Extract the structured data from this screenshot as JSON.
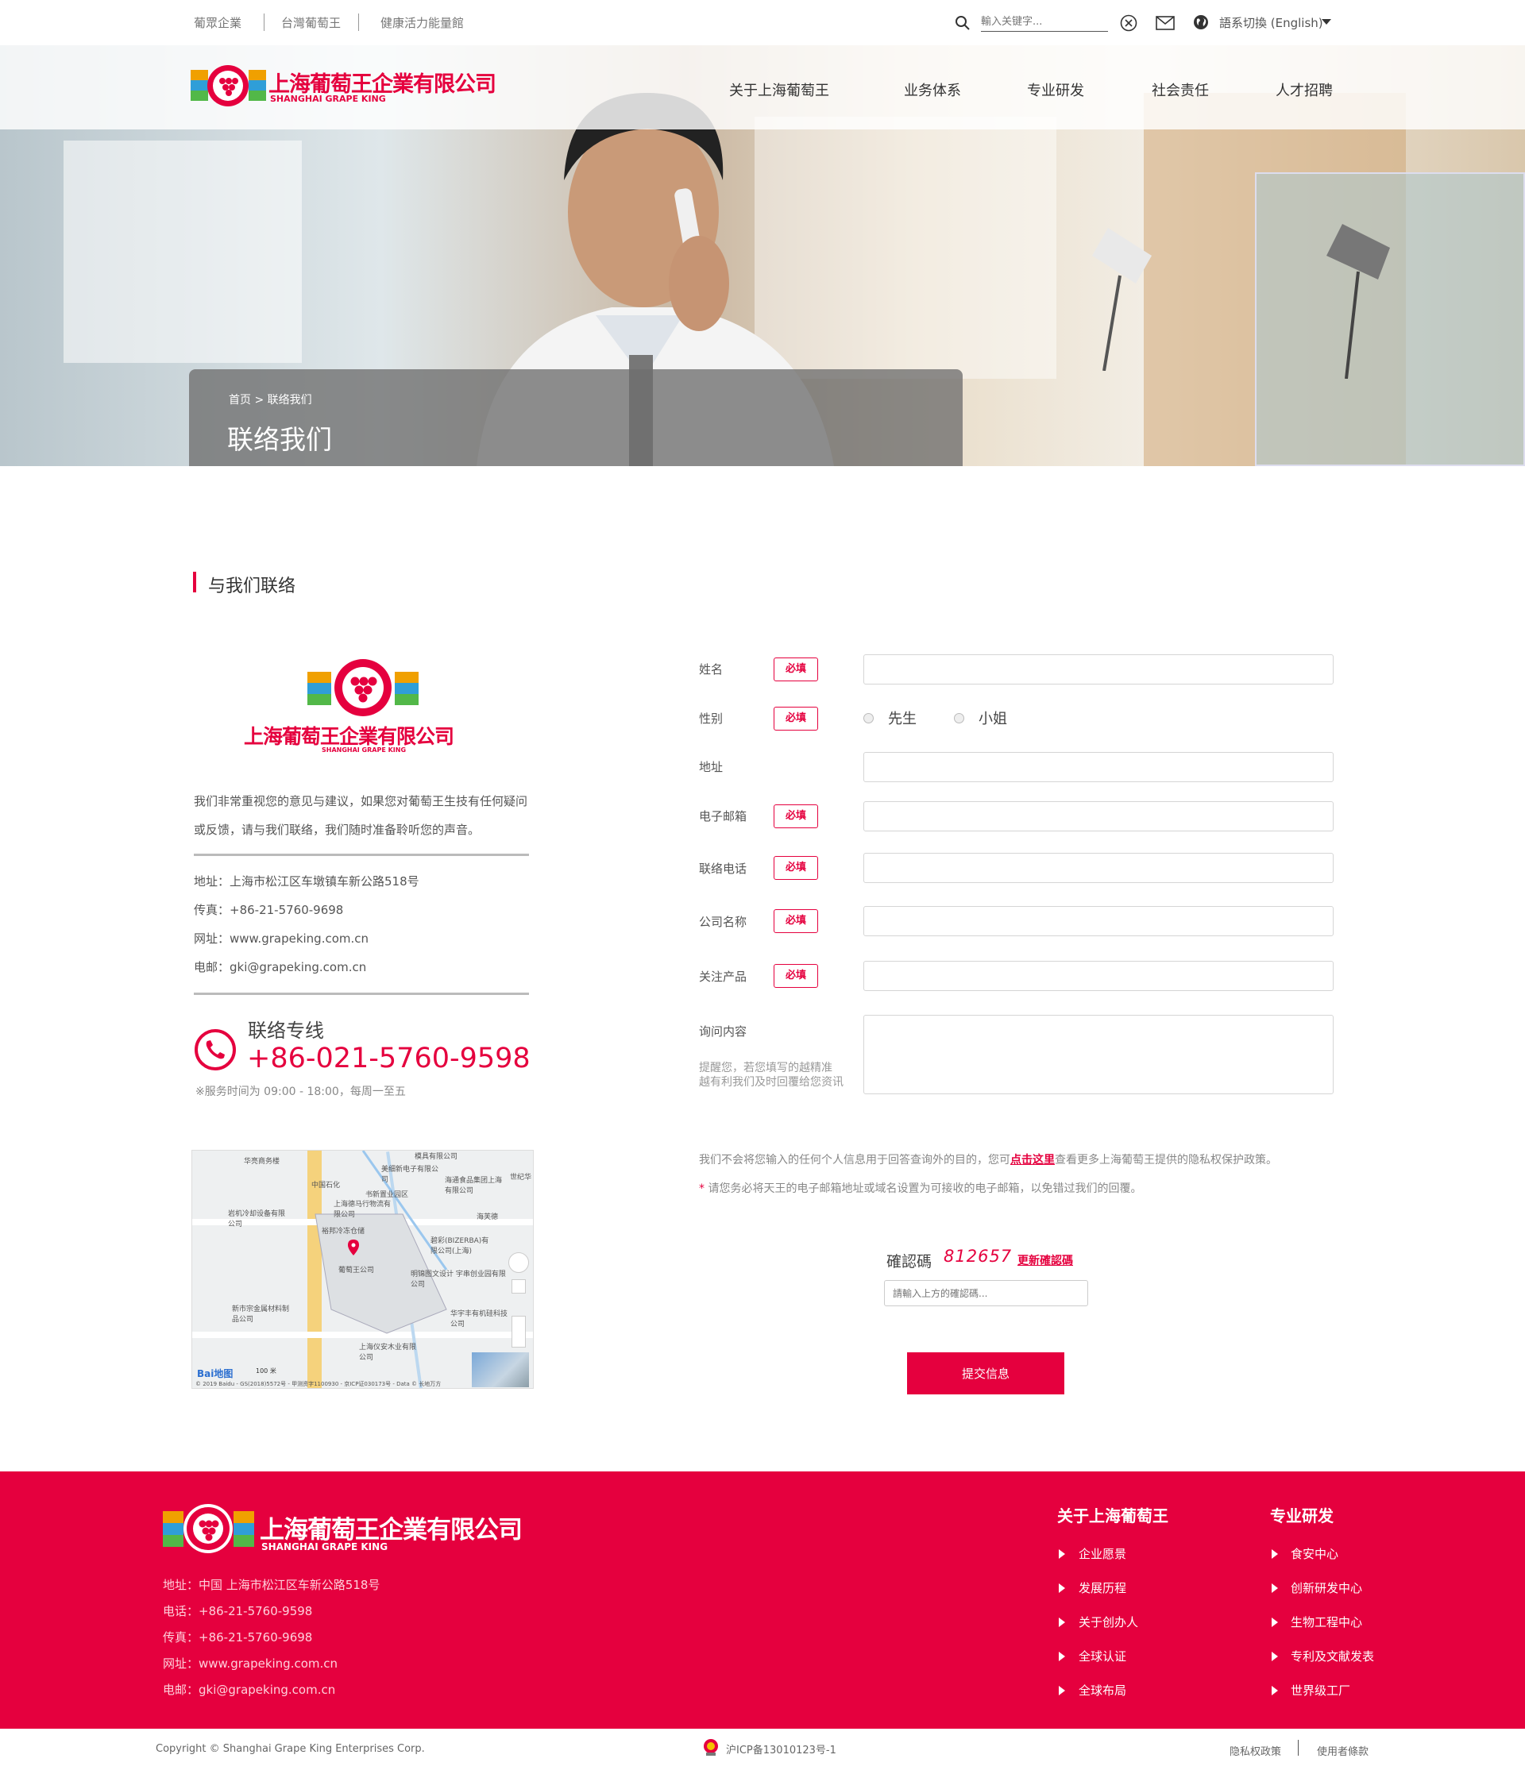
{
  "topbar": {
    "links": [
      "葡眾企業",
      "台灣葡萄王",
      "健康活力能量館"
    ],
    "search_placeholder": "輸入关键字...",
    "language": "語系切換 (English)"
  },
  "logo": {
    "cn": "上海葡萄王企業有限公司",
    "en": "SHANGHAI GRAPE KING"
  },
  "nav": [
    "关于上海葡萄王",
    "业务体系",
    "专业研发",
    "社会责任",
    "人才招聘"
  ],
  "breadcrumb": {
    "home": "首页",
    "sep": ">",
    "current": "联络我们"
  },
  "hero_title": "联络我们",
  "section_title": "与我们联络",
  "intro": {
    "line1": "我们非常重视您的意见与建议，如果您对葡萄王生技有任何疑问",
    "line2": "或反馈，请与我们联络，我们随时准备聆听您的声音。"
  },
  "contact": {
    "address": "地址：上海市松江区车墩镇车新公路518号",
    "fax": "传真：+86-21-5760-9698",
    "web": "网址：www.grapeking.com.cn",
    "email": "电邮：gki@grapeking.com.cn"
  },
  "hotline": {
    "title": "联络专线",
    "number": "+86-021-5760-9598",
    "hours": "※服务时间为 09:00 - 18:00，每周一至五"
  },
  "map": {
    "pin": "葡萄王公司",
    "pois": [
      "华亮商务楼",
      "中国石化",
      "上海德马行物流有限公司",
      "裕邦冷冻仓储",
      "美细新电子有限公司",
      "海通食品集团上海有限公司",
      "书新置业园区",
      "海芙德",
      "岩机冷却设备有限公司",
      "碧彩(BIZERBA)有限公司(上海)",
      "明锦图文设计 宇串创业园有限公司",
      "新市宗金属材料制品公司",
      "华宇丰有机硅科技公司",
      "上海仪安木业有限公司",
      "模具有限公司",
      "世纪华"
    ],
    "brand": "Bai地图",
    "scale": "100 米",
    "copyright": "© 2019 Baidu - GS(2018)5572号 - 甲测资字1100930 - 京ICP证030173号 - Data © 长地万方"
  },
  "form": {
    "required_label": "必填",
    "fields": {
      "name": "姓名",
      "gender": "性别",
      "address": "地址",
      "email": "电子邮箱",
      "phone": "联络电话",
      "company": "公司名称",
      "product": "关注产品",
      "inquiry": "询问内容"
    },
    "gender_options": [
      "先生",
      "小姐"
    ],
    "inquiry_hint1": "提醒您，若您填写的越精准",
    "inquiry_hint2": "越有利我们及时回覆给您资讯",
    "privacy_pre": "我们不会将您输入的任何个人信息用于回答查询外的目的，您可",
    "privacy_link": "点击这里",
    "privacy_post": "查看更多上海葡萄王提供的隐私权保护政策。",
    "note_star": "*",
    "note": "请您务必将天王的电子邮箱地址或域名设置为可接收的电子邮箱，以免错过我们的回覆。",
    "captcha_label": "確認碼",
    "captcha_code": "812657",
    "captcha_refresh": "更新確認碼",
    "captcha_placeholder": "請輸入上方的確認碼...",
    "submit": "提交信息"
  },
  "footer": {
    "address": "地址：中国 上海市松江区车新公路518号",
    "phone": "电话：+86-21-5760-9598",
    "fax": "传真：+86-21-5760-9698",
    "web": "网址：www.grapeking.com.cn",
    "email": "电邮：gki@grapeking.com.cn",
    "col1_title": "关于上海葡萄王",
    "col1_items": [
      "企业愿景",
      "发展历程",
      "关于创办人",
      "全球认证",
      "全球布局"
    ],
    "col2_title": "专业研发",
    "col2_items": [
      "食安中心",
      "创新研发中心",
      "生物工程中心",
      "专利及文献发表",
      "世界级工厂"
    ]
  },
  "bottom": {
    "copyright": "Copyright © Shanghai Grape King Enterprises Corp.",
    "icp": "沪ICP备13010123号-1",
    "privacy": "隐私权政策",
    "terms": "使用者條款"
  },
  "colors": {
    "brand_red": "#e5003e"
  }
}
